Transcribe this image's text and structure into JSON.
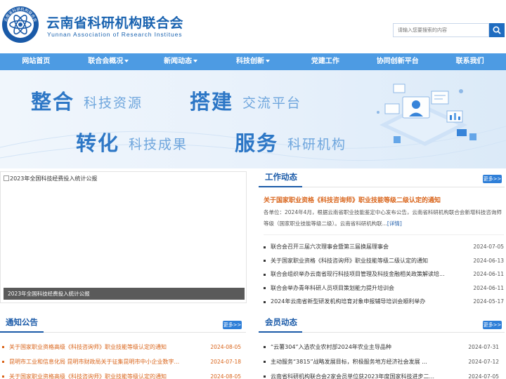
{
  "header": {
    "title_cn": "云南省科研机构联合会",
    "title_en": "Yunnan Association of Research Institues",
    "logo_text": "云南省科研机构联合会",
    "search_placeholder": "请输入您要搜索的内容"
  },
  "nav": [
    {
      "label": "网站首页",
      "dropdown": false
    },
    {
      "label": "联合会概况",
      "dropdown": true
    },
    {
      "label": "新闻动态",
      "dropdown": true
    },
    {
      "label": "科技创新",
      "dropdown": true
    },
    {
      "label": "党建工作",
      "dropdown": false
    },
    {
      "label": "协同创新平台",
      "dropdown": false
    },
    {
      "label": "联系我们",
      "dropdown": false
    }
  ],
  "banner": {
    "w1": "整合",
    "s1": "科技资源",
    "w2": "搭建",
    "s2": "交流平台",
    "w3": "转化",
    "s3": "科技成果",
    "w4": "服务",
    "s4": "科研机构"
  },
  "feature": {
    "alt": "2023年全国科技经费投入统计公报",
    "caption": "2023年全国科技经费投入统计公报"
  },
  "work": {
    "title": "工作动态",
    "more": "更多>>",
    "headline": "关于国家职业资格《科技咨询师》职业技能等级二级认定的通知",
    "summary": "各单位：2024年4月，根据云南省职业技能鉴定中心发布公告，云南省科研机构联合会新增科技咨询师等级（国家职业技能等级二级）。云南省科研机构联...",
    "summary_more": "[详情]",
    "items": [
      {
        "text": "联合会召开三届六次理事会暨第三届换届理事会",
        "date": "2024-07-05"
      },
      {
        "text": "关于国家职业资格《科技咨询师》职业技能等级二级认定的通知",
        "date": "2024-06-13"
      },
      {
        "text": "联合会组织举办云南省现行科技项目管理及科技金融相关政策解读培...",
        "date": "2024-06-11"
      },
      {
        "text": "联合会举办青年科研人员项目策划能力提升培训会",
        "date": "2024-06-11"
      },
      {
        "text": "2024年云南省新型研发机构培育对象申报辅导培训会顺利举办",
        "date": "2024-05-17"
      }
    ]
  },
  "notice": {
    "title": "通知公告",
    "more": "更多>>",
    "items": [
      {
        "text": "关于国家职业资格高级《科技咨询师》职业技能等级认定的通知",
        "date": "2024-08-05"
      },
      {
        "text": "昆明市工业和信息化局 昆明市财政局关于征集昆明市中小企业数字...",
        "date": "2024-07-18"
      },
      {
        "text": "关于国家职业资格高级《科技咨询师》职业技能等级认定的通知",
        "date": "2024-08-05"
      }
    ]
  },
  "member": {
    "title": "会员动态",
    "more": "更多>>",
    "items": [
      {
        "text": "“云薯304”入选农业农村部2024年农业主导品种",
        "date": "2024-07-31"
      },
      {
        "text": "主动服务“3815”战略发展目标，积极服务地方经济社会发展 ...",
        "date": "2024-07-12"
      },
      {
        "text": "云南省科研机构联合会2家会员单位获2023年度国家科技进步二...",
        "date": "2024-07-05"
      }
    ]
  },
  "colors": {
    "brand": "#1a63b0",
    "nav": "#4d9be3",
    "accent_orange": "#d9641a"
  }
}
